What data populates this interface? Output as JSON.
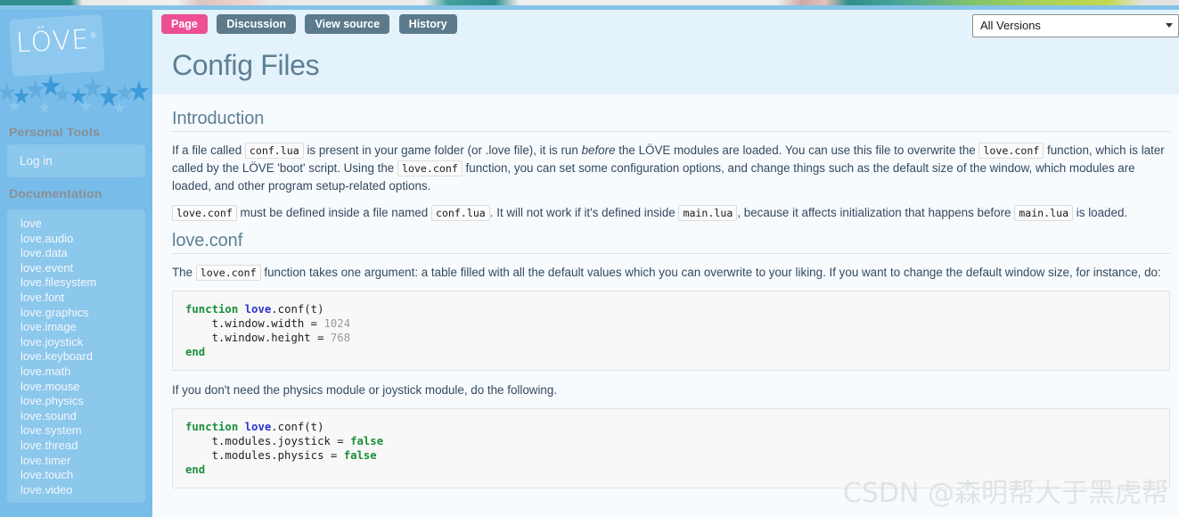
{
  "sidebar": {
    "logo_text": "LÖVE",
    "logo_mark": "®",
    "personal_tools_heading": "Personal Tools",
    "login_label": "Log in",
    "documentation_heading": "Documentation",
    "nav_items": [
      {
        "label": "love"
      },
      {
        "label": "love.audio"
      },
      {
        "label": "love.data"
      },
      {
        "label": "love.event"
      },
      {
        "label": "love.filesystem"
      },
      {
        "label": "love.font"
      },
      {
        "label": "love.graphics"
      },
      {
        "label": "love.image"
      },
      {
        "label": "love.joystick"
      },
      {
        "label": "love.keyboard"
      },
      {
        "label": "love.math"
      },
      {
        "label": "love.mouse"
      },
      {
        "label": "love.physics"
      },
      {
        "label": "love.sound"
      },
      {
        "label": "love.system"
      },
      {
        "label": "love.thread"
      },
      {
        "label": "love.timer"
      },
      {
        "label": "love.touch"
      },
      {
        "label": "love.video"
      }
    ]
  },
  "tabs": [
    {
      "label": "Page",
      "active": true
    },
    {
      "label": "Discussion",
      "active": false
    },
    {
      "label": "View source",
      "active": false
    },
    {
      "label": "History",
      "active": false
    }
  ],
  "version_select": {
    "selected": "All Versions",
    "options": [
      "All Versions"
    ]
  },
  "page": {
    "title": "Config Files"
  },
  "sections": {
    "introduction": {
      "heading": "Introduction",
      "p1_a": "If a file called ",
      "p1_code1": "conf.lua",
      "p1_b": " is present in your game folder (or .love file), it is run ",
      "p1_em": "before",
      "p1_c": " the LÖVE modules are loaded. You can use this file to overwrite the ",
      "p1_code2": "love.conf",
      "p1_d": " function, which is later called by the LÖVE 'boot' script. Using the ",
      "p1_code3": "love.conf",
      "p1_e": " function, you can set some configuration options, and change things such as the default size of the window, which modules are loaded, and other program setup-related options.",
      "p2_code1": "love.conf",
      "p2_a": " must be defined inside a file named ",
      "p2_code2": "conf.lua",
      "p2_b": ". It will not work if it's defined inside ",
      "p2_code3": "main.lua",
      "p2_c": ", because it affects initialization that happens before ",
      "p2_code4": "main.lua",
      "p2_d": " is loaded."
    },
    "loveconf": {
      "heading": "love.conf",
      "p1_a": "The ",
      "p1_code1": "love.conf",
      "p1_b": " function takes one argument: a table filled with all the default values which you can overwrite to your liking. If you want to change the default window size, for instance, do:",
      "code1": {
        "l1_kw": "function",
        "l1_mod": " love",
        "l1_rest": ".conf(t)",
        "l2": "    t.window.width = ",
        "l2_num": "1024",
        "l3": "    t.window.height = ",
        "l3_num": "768",
        "l4_kw": "end"
      },
      "p2": "If you don't need the physics module or joystick module, do the following.",
      "code2": {
        "l1_kw": "function",
        "l1_mod": " love",
        "l1_rest": ".conf(t)",
        "l2": "    t.modules.joystick = ",
        "l2_val": "false",
        "l3": "    t.modules.physics = ",
        "l3_val": "false",
        "l4_kw": "end"
      }
    }
  },
  "watermark": "CSDN @森明帮大于黑虎帮",
  "colors": {
    "sidebar_bg": "#78bcea",
    "tab_active": "#ec4f94",
    "tab_inactive": "#5c7a8c",
    "heading": "#5d7f93",
    "body_text": "#34495e",
    "content_bg": "#f7fbfe",
    "title_band_bg": "#e3f2fb"
  }
}
